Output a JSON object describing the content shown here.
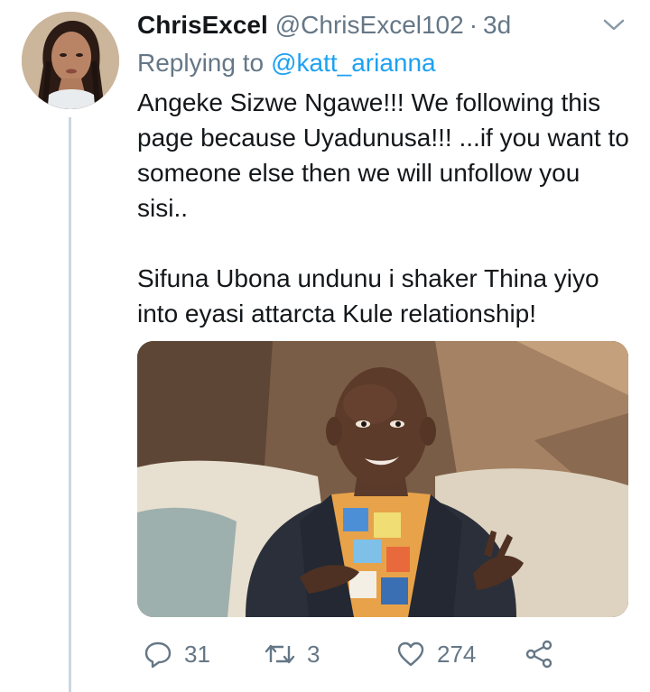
{
  "tweet": {
    "display_name": "ChrisExcel",
    "handle": "@ChrisExcel102",
    "separator": "·",
    "time": "3d",
    "replying_prefix": "Replying to",
    "replying_to": "@katt_arianna",
    "body_lines": [
      "Angeke Sizwe Ngawe!!! We following this page because Uyadunusa!!! ...if you want to someone else then we will unfollow you sisi..",
      "Sifuna Ubona undunu i shaker Thina yiyo into eyasi attarcta Kule relationship!"
    ],
    "actions": {
      "reply_count": "31",
      "retweet_count": "3",
      "like_count": "274"
    },
    "icons": {
      "reply": "speech-bubble-icon",
      "retweet": "retweet-arrows-icon",
      "like": "heart-icon",
      "share": "share-icon",
      "menu": "chevron-down-icon"
    },
    "colors": {
      "link": "#1da1f2",
      "secondary_text": "#657786",
      "thread_line": "#ccd6dd"
    }
  }
}
